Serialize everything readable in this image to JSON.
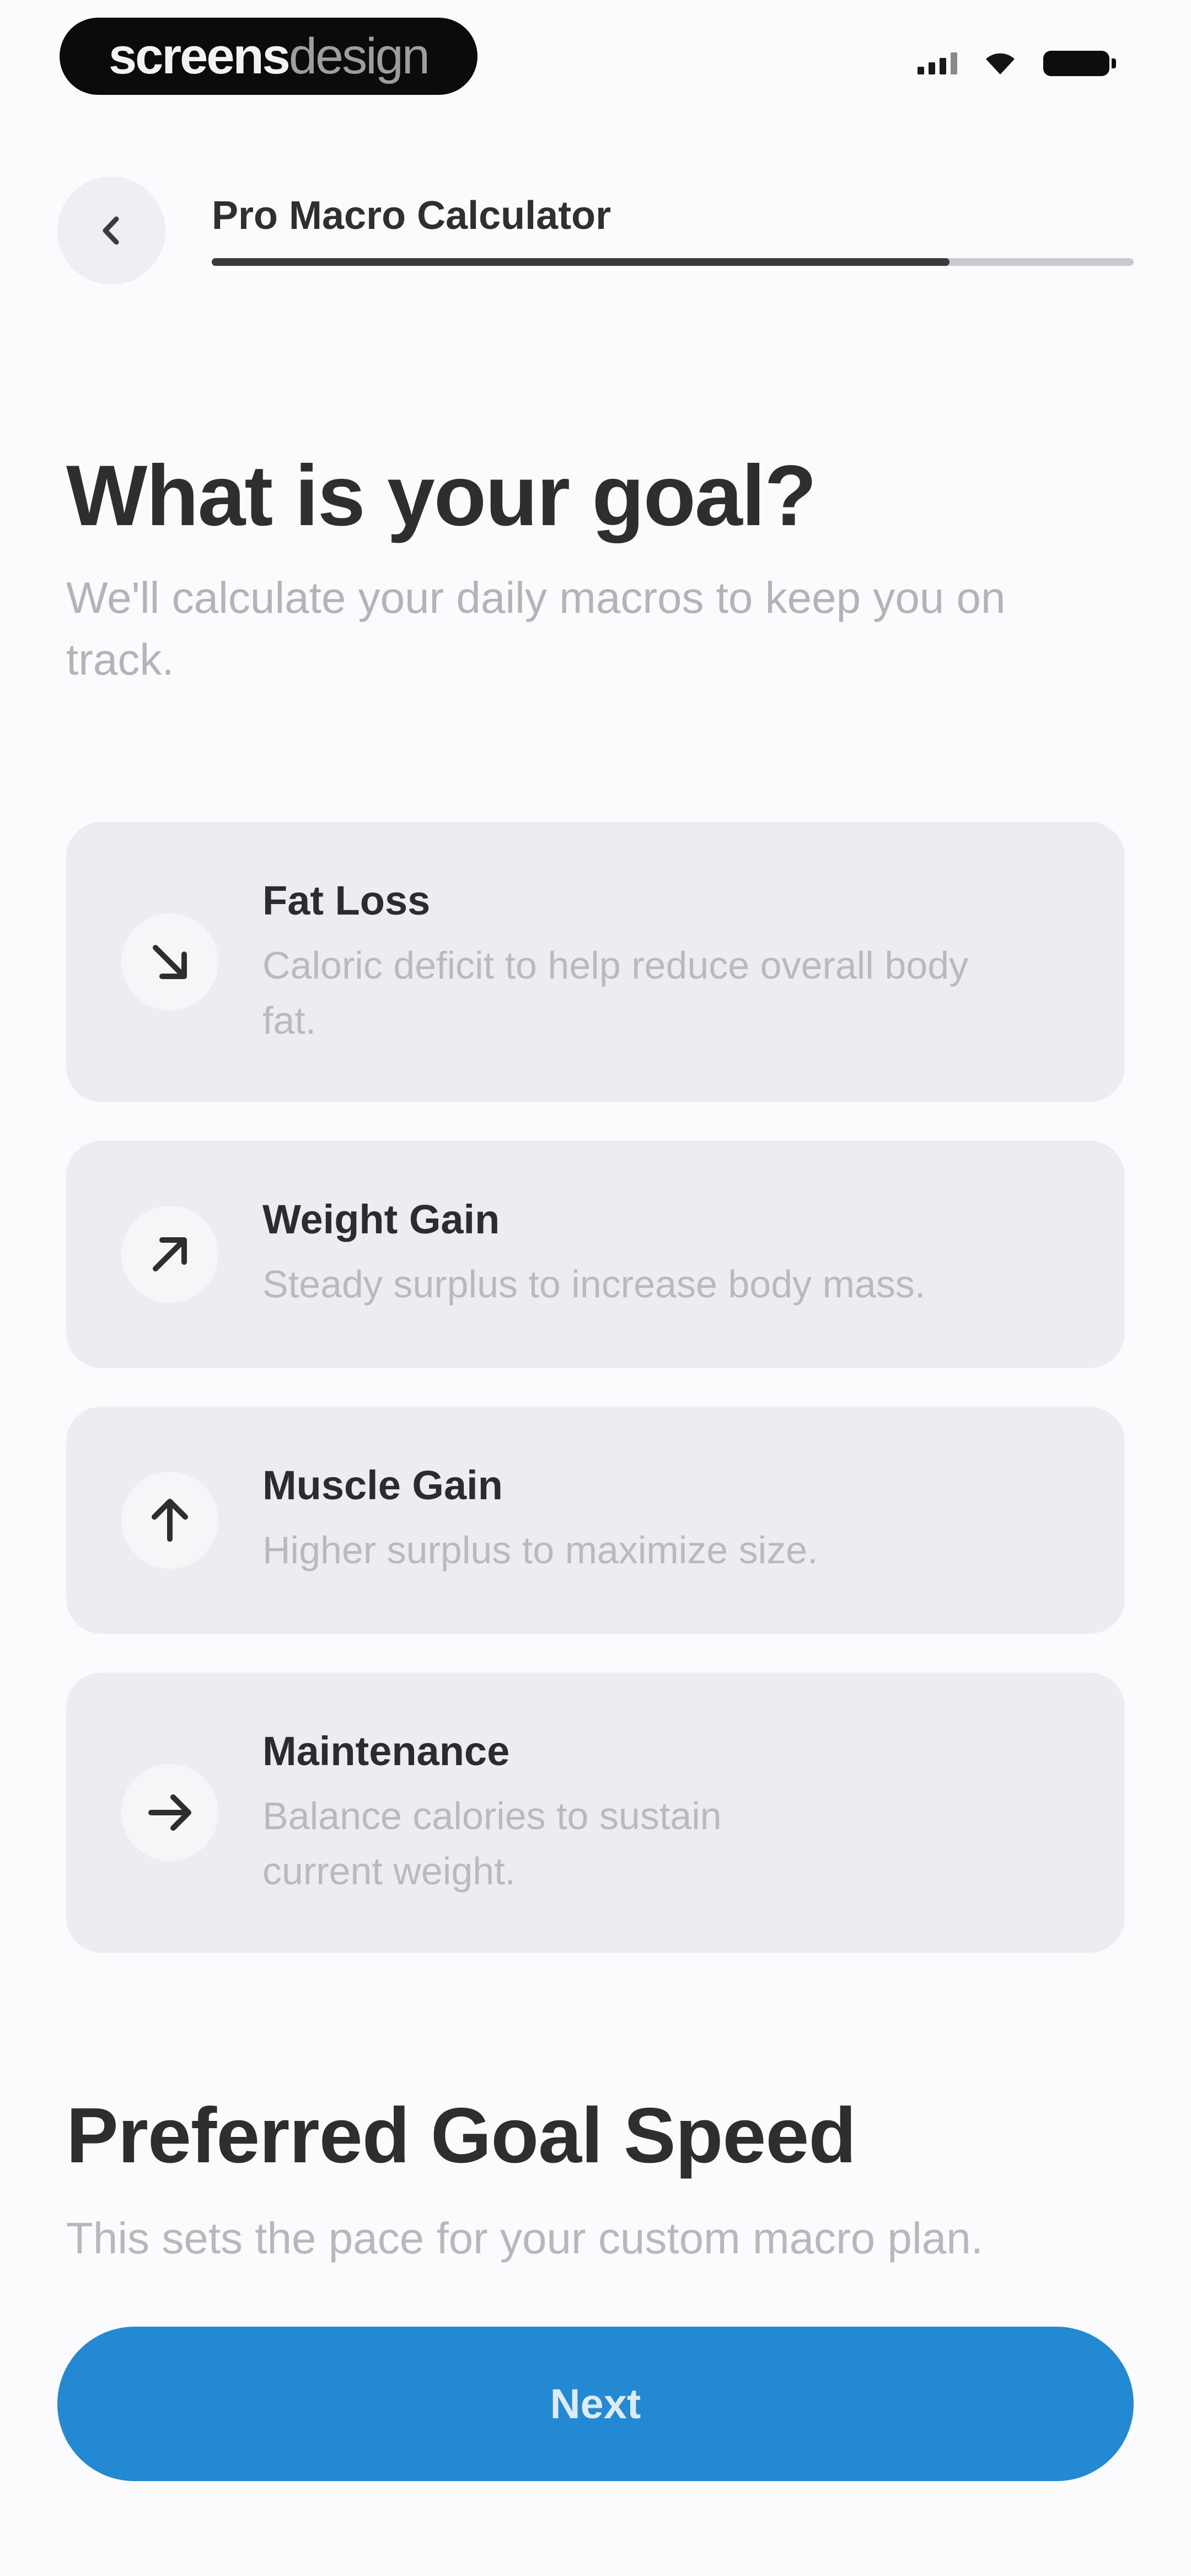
{
  "status_bar": {
    "brand_strong": "screens",
    "brand_light": "design",
    "icons": [
      "signal-icon",
      "wifi-icon",
      "battery-icon"
    ]
  },
  "header": {
    "back_icon": "chevron-left-icon",
    "title": "Pro Macro Calculator",
    "progress": 0.8
  },
  "question": {
    "title": "What is your goal?",
    "subtitle": "We'll calculate your daily macros to keep you on track."
  },
  "options": [
    {
      "icon": "arrow-down-right-icon",
      "title": "Fat Loss",
      "description": "Caloric deficit to help reduce overall body fat."
    },
    {
      "icon": "arrow-up-right-icon",
      "title": "Weight Gain",
      "description": "Steady surplus to increase body mass."
    },
    {
      "icon": "arrow-up-icon",
      "title": "Muscle Gain",
      "description": "Higher surplus to maximize size."
    },
    {
      "icon": "arrow-right-icon",
      "title": "Maintenance",
      "description": "Balance calories to sustain current weight."
    }
  ],
  "speed": {
    "title": "Preferred Goal Speed",
    "subtitle": "This sets the pace for your custom macro plan."
  },
  "footer": {
    "next_label": "Next"
  },
  "colors": {
    "accent": "#2389d2",
    "card_bg": "#ececf2",
    "progress_fill": "#3a3a3c",
    "progress_track": "#c9c9ce"
  }
}
